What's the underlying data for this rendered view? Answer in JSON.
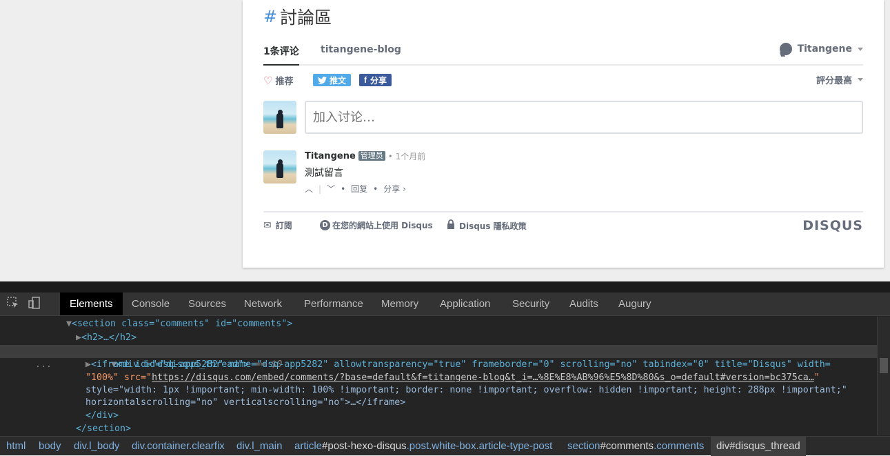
{
  "disqus": {
    "hash": "#",
    "title": "討論區",
    "tab_count": "1条评论",
    "tab_blog": "titangene-blog",
    "username": "Titangene",
    "recommend": "推荐",
    "tweet": "推文",
    "share": "分享",
    "sort": "評分最高",
    "composer_placeholder": "加入讨论…",
    "comment": {
      "author": "Titangene",
      "badge": "管理员",
      "time": "• 1个月前",
      "body": "測試留言",
      "reply": "回复",
      "share": "分享 ›"
    },
    "footer": {
      "subscribe": "訂閱",
      "use": "在您的網站上使用 Disqus",
      "privacy": "Disqus 隱私政策",
      "logo": "DISQUS"
    }
  },
  "devtools": {
    "tabs": [
      "Elements",
      "Console",
      "Sources",
      "Network",
      "Performance",
      "Memory",
      "Application",
      "Security",
      "Audits",
      "Augury"
    ],
    "lines": {
      "l1": "<section class=\"comments\" id=\"comments\">",
      "l2": "<h2>…</h2>",
      "l3_tag": "<div id=\"disqus_thread\">",
      "l3_eq": " == $0",
      "l4": "<iframe id=\"dsq-app5282\" name=\"dsq-app5282\" allowtransparency=\"true\" frameborder=\"0\" scrolling=\"no\" tabindex=\"0\" title=\"Disqus\" width=",
      "l5_pre": "\"100%\" src=\"",
      "l5_url": "https://disqus.com/embed/comments/?base=default&f=titangene-blog&t_i=…%8E%E8%AB%96%E5%8D%80&s_o=default#version=bc375ca…",
      "l5_post": "\"",
      "l6": "style=\"width: 1px !important; min-width: 100% !important; border: none !important; overflow: hidden !important; height: 288px !important;\"",
      "l7": "horizontalscrolling=\"no\" verticalscrolling=\"no\">…</iframe>",
      "l8": "</div>",
      "l9": "</section>",
      "dots": "..."
    },
    "breadcrumbs": {
      "c1": "html",
      "c2": "body",
      "c3": "div.l_body",
      "c4": "div.container.clearfix",
      "c5": "div.l_main",
      "c6a": "article",
      "c6b": "#post-hexo-disqus",
      "c6c": ".post.white-box.article-type-post",
      "c7a": "section",
      "c7b": "#comments",
      "c7c": ".comments",
      "c8": "div#disqus_thread"
    }
  }
}
